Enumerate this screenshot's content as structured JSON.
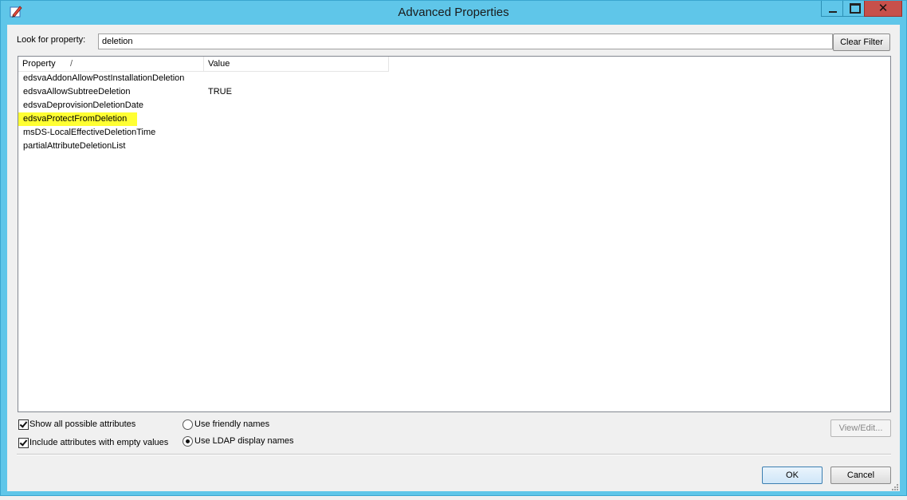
{
  "window": {
    "title": "Advanced Properties",
    "close_glyph": "✕"
  },
  "search": {
    "label": "Look for property:",
    "value": "deletion",
    "clear_label": "Clear Filter"
  },
  "list": {
    "columns": {
      "property": "Property",
      "sort_indicator": "/",
      "value": "Value"
    },
    "rows": [
      {
        "property": "edsvaAddonAllowPostInstallationDeletion",
        "value": ""
      },
      {
        "property": "edsvaAllowSubtreeDeletion",
        "value": "TRUE"
      },
      {
        "property": "edsvaDeprovisionDeletionDate",
        "value": ""
      },
      {
        "property": "edsvaProtectFromDeletion",
        "value": "",
        "highlighted": true
      },
      {
        "property": "msDS-LocalEffectiveDeletionTime",
        "value": ""
      },
      {
        "property": "partialAttributeDeletionList",
        "value": ""
      }
    ]
  },
  "options": {
    "show_all_label": "Show all possible attributes",
    "show_all_checked": true,
    "include_empty_label": "Include attributes with empty values",
    "include_empty_checked": true,
    "friendly_label": "Use friendly names",
    "ldap_label": "Use LDAP display names",
    "name_mode": "ldap"
  },
  "buttons": {
    "view_edit": "View/Edit...",
    "ok": "OK",
    "cancel": "Cancel"
  },
  "colors": {
    "titlebar": "#5fc6e9",
    "highlight": "#ffff33",
    "close": "#c7504b"
  }
}
